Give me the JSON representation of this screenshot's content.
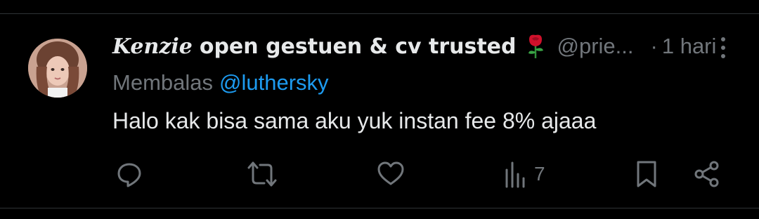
{
  "post": {
    "display_name_script": "Kenzie",
    "display_name_rest": "open gestuen & cv trusted",
    "name_emoji": "rose-icon",
    "handle": "@prie...",
    "separator": "·",
    "timestamp": "1 hari",
    "reply_prefix": "Membalas",
    "reply_mention": "@luthersky",
    "text": "Halo kak bisa sama aku yuk instan fee 8% ajaaa"
  },
  "actions": {
    "reply_icon": "reply-icon",
    "repost_icon": "repost-icon",
    "like_icon": "like-icon",
    "views_icon": "views-icon",
    "views_count": "7",
    "bookmark_icon": "bookmark-icon",
    "share_icon": "share-icon"
  },
  "colors": {
    "background": "#000000",
    "primary_text": "#e7e9ea",
    "secondary_text": "#71767b",
    "accent_blue": "#1d9bf0",
    "divider": "#2f3336",
    "rose_red": "#d0112b"
  }
}
